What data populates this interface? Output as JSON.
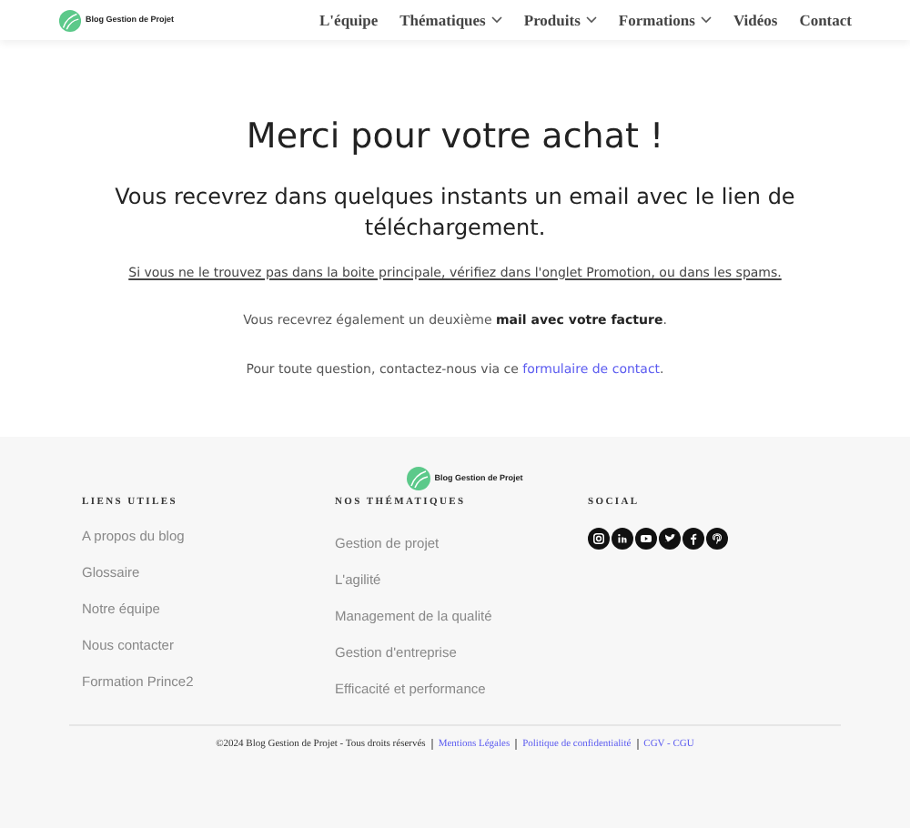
{
  "header": {
    "logo_text": "Blog Gestion de Projet",
    "nav": [
      {
        "label": "L'équipe",
        "has_menu": false
      },
      {
        "label": "Thématiques",
        "has_menu": true
      },
      {
        "label": "Produits",
        "has_menu": true
      },
      {
        "label": "Formations",
        "has_menu": true
      },
      {
        "label": "Vidéos",
        "has_menu": false
      },
      {
        "label": "Contact",
        "has_menu": false
      }
    ]
  },
  "main": {
    "title": "Merci pour votre achat !",
    "subtitle": "Vous recevrez dans quelques instants un email avec le lien de téléchargement.",
    "notice": "Si vous ne le trouvez pas dans la boite principale, vérifiez dans l'onglet Promotion, ou dans les spams.",
    "invoice": "Vous recevrez également un deuxième **mail avec votre facture**.",
    "contact": {
      "text": "Pour toute question, contactez-nous via ce ",
      "link": "formulaire de contact",
      "after": "."
    }
  },
  "footer": {
    "logo_text": "Blog Gestion de Projet",
    "columns": [
      {
        "heading": "LIENS UTILES",
        "links": [
          "A propos du blog",
          "Glossaire",
          "Notre équipe",
          "Nous contacter",
          "Formation Prince2"
        ]
      },
      {
        "heading": "NOS THÉMATIQUES",
        "links": [
          "Gestion de projet",
          "L'agilité",
          "Management de la qualité",
          "Gestion d'entreprise",
          "Efficacité et performance"
        ]
      },
      {
        "heading": "SOCIAL"
      }
    ],
    "copyright": "©2024 Blog Gestion de Projet  - Tous droits réservés",
    "legal_links": [
      "Mentions Légales",
      "Politique de confidentialité",
      "CGV - CGU"
    ]
  }
}
